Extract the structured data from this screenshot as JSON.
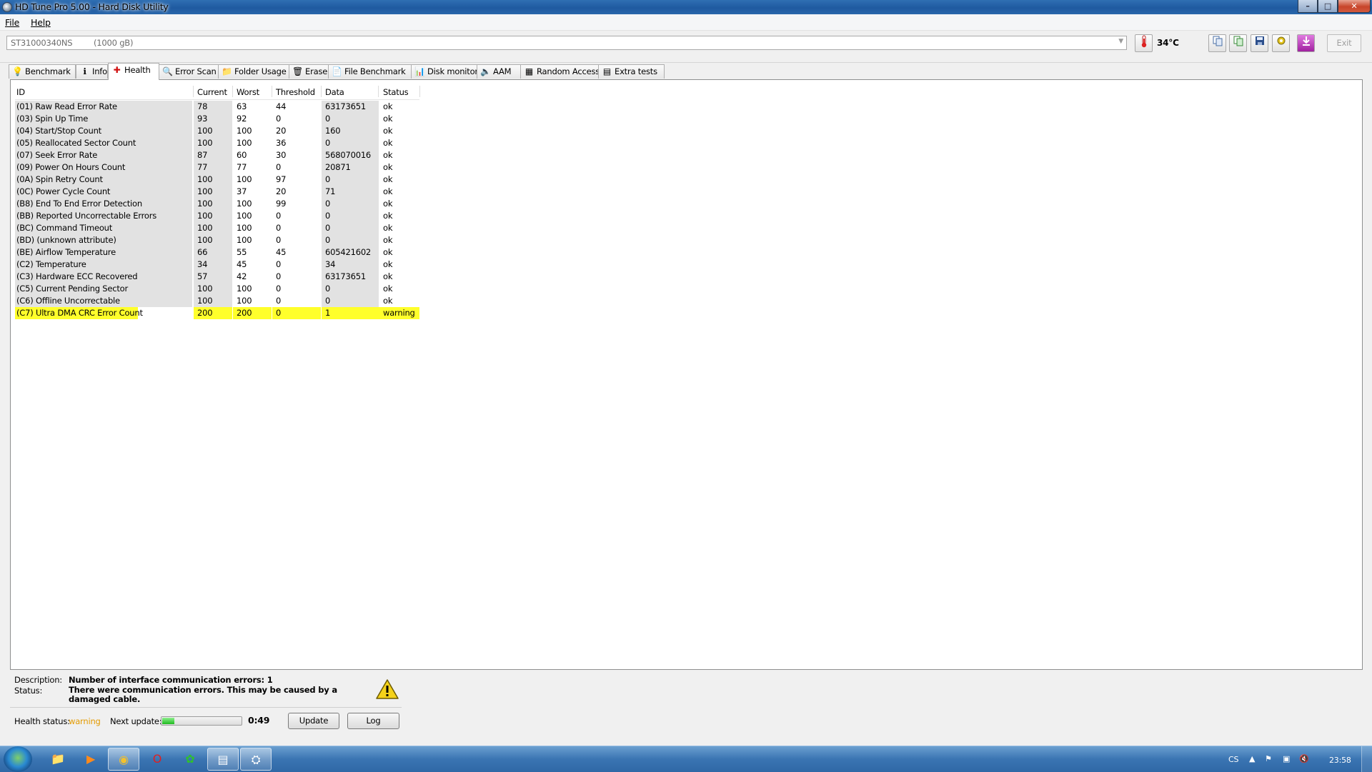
{
  "window": {
    "title": "HD Tune Pro 5.00 - Hard Disk Utility",
    "controls": {
      "minimize": "–",
      "maximize": "□",
      "close": "✕"
    }
  },
  "menu": [
    {
      "label": "File",
      "icon": ""
    },
    {
      "label": "Help",
      "icon": ""
    }
  ],
  "toolbar": {
    "drive_name": "ST31000340NS",
    "drive_size": "(1000 gB)",
    "temperature": "34°C",
    "exit_label": "Exit",
    "icons": [
      "copy-text-icon",
      "copy-screenshot-icon",
      "save-icon",
      "options-icon",
      "download-icon"
    ]
  },
  "tabs": [
    {
      "label": "Benchmark",
      "icon": "benchmark-icon"
    },
    {
      "label": "Info",
      "icon": "info-icon"
    },
    {
      "label": "Health",
      "icon": "health-icon",
      "active": true
    },
    {
      "label": "Error Scan",
      "icon": "error-scan-icon"
    },
    {
      "label": "Folder Usage",
      "icon": "folder-icon"
    },
    {
      "label": "Erase",
      "icon": "erase-icon"
    },
    {
      "label": "File Benchmark",
      "icon": "file-benchmark-icon"
    },
    {
      "label": "Disk monitor",
      "icon": "disk-monitor-icon"
    },
    {
      "label": "AAM",
      "icon": "speaker-icon"
    },
    {
      "label": "Random Access",
      "icon": "random-access-icon"
    },
    {
      "label": "Extra tests",
      "icon": "extra-tests-icon"
    }
  ],
  "table": {
    "headers": [
      "ID",
      "Current",
      "Worst",
      "Threshold",
      "Data",
      "Status"
    ],
    "rows": [
      [
        "(01) Raw Read Error Rate",
        "78",
        "63",
        "44",
        "63173651",
        "ok"
      ],
      [
        "(03) Spin Up Time",
        "93",
        "92",
        "0",
        "0",
        "ok"
      ],
      [
        "(04) Start/Stop Count",
        "100",
        "100",
        "20",
        "160",
        "ok"
      ],
      [
        "(05) Reallocated Sector Count",
        "100",
        "100",
        "36",
        "0",
        "ok"
      ],
      [
        "(07) Seek Error Rate",
        "87",
        "60",
        "30",
        "568070016",
        "ok"
      ],
      [
        "(09) Power On Hours Count",
        "77",
        "77",
        "0",
        "20871",
        "ok"
      ],
      [
        "(0A) Spin Retry Count",
        "100",
        "100",
        "97",
        "0",
        "ok"
      ],
      [
        "(0C) Power Cycle Count",
        "100",
        "37",
        "20",
        "71",
        "ok"
      ],
      [
        "(B8) End To End Error Detection",
        "100",
        "100",
        "99",
        "0",
        "ok"
      ],
      [
        "(BB) Reported Uncorrectable Errors",
        "100",
        "100",
        "0",
        "0",
        "ok"
      ],
      [
        "(BC) Command Timeout",
        "100",
        "100",
        "0",
        "0",
        "ok"
      ],
      [
        "(BD) (unknown attribute)",
        "100",
        "100",
        "0",
        "0",
        "ok"
      ],
      [
        "(BE) Airflow Temperature",
        "66",
        "55",
        "45",
        "605421602",
        "ok"
      ],
      [
        "(C2) Temperature",
        "34",
        "45",
        "0",
        "34",
        "ok"
      ],
      [
        "(C3) Hardware ECC Recovered",
        "57",
        "42",
        "0",
        "63173651",
        "ok"
      ],
      [
        "(C5) Current Pending Sector",
        "100",
        "100",
        "0",
        "0",
        "ok"
      ],
      [
        "(C6) Offline Uncorrectable",
        "100",
        "100",
        "0",
        "0",
        "ok"
      ],
      [
        "(C7) Ultra DMA CRC Error Count",
        "200",
        "200",
        "0",
        "1",
        "warning"
      ]
    ],
    "warning_color": "#ffff2b"
  },
  "details": {
    "description_label": "Description:",
    "description_value": "Number of interface communication errors: 1",
    "status_label": "Status:",
    "status_value": "There were communication errors. This may be caused by a damaged cable.",
    "health_label": "Health status:",
    "health_value": "warning",
    "health_color": "#e39a00",
    "next_update_label": "Next update:",
    "next_update_time": "0:49",
    "next_update_progress": 0.15,
    "update_button": "Update",
    "log_button": "Log"
  },
  "taskbar": {
    "apps": [
      "explorer-icon",
      "media-player-icon",
      "chrome-icon",
      "opera-icon",
      "puzzle-icon",
      "winrar-icon",
      "hdtune-icon"
    ],
    "language": "CS",
    "clock": "23:58"
  }
}
